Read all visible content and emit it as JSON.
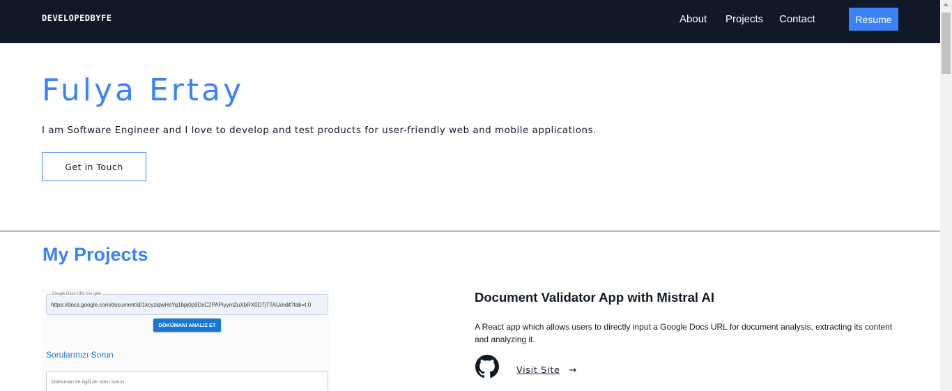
{
  "navbar": {
    "logo": "DEVELOPEDBYFE",
    "links": [
      "About",
      "Projects",
      "Contact"
    ],
    "resume_label": "Resume"
  },
  "hero": {
    "name": "Fulya Ertay",
    "tagline": "I am Software Engineer and I love to develop and test products for user-friendly web and mobile applications.",
    "cta_label": "Get in Touch"
  },
  "projects": {
    "section_title": "My Projects",
    "items": [
      {
        "title": "Document Validator App with Mistral AI",
        "description": "A React app which allows users to directly input a Google Docs URL for document analysis, extracting its content and analyzing it.",
        "visit_label": "Visit Site",
        "arrow_icon": "→",
        "github_icon": "github-icon",
        "screenshot": {
          "url_label": "Google Docs URL'sini girin",
          "url_value": "https://docs.google.com/document/d/1kcyziqwHsYq1bpj0p9DsC2PAPiyym2uXbRX0D7jTTAU/edit?tab=t.0",
          "analyze_button": "DÖKÜMANI ANALIZ ET",
          "questions_heading": "Sorularınızı Sorun",
          "question_placeholder": "Doküman ile ilgili bir soru sorun"
        }
      }
    ]
  },
  "colors": {
    "accent": "#3b82f6",
    "navbar_bg": "#111827",
    "text": "#111827"
  }
}
